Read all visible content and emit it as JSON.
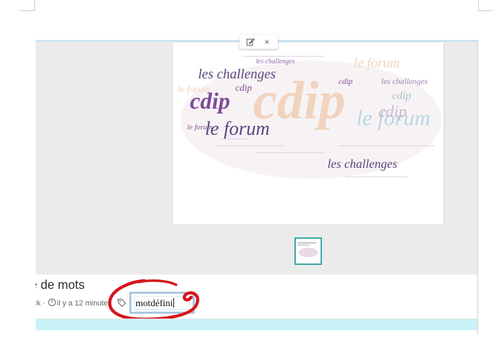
{
  "toolbar": {
    "edit_icon": "edit-icon",
    "close_label": "×"
  },
  "wordcloud": {
    "words": [
      "cdip",
      "cdip",
      "le forum",
      "les challenges",
      "le forum",
      "les challenges",
      "cdip",
      "cdip",
      "le forum",
      "cdip",
      "les challenges",
      "le forum",
      "cdip",
      "le forum",
      "les challenges"
    ]
  },
  "post": {
    "title_visible": "ge de mots",
    "meta_visible": "ck · ",
    "time_text": "il y a 12 minutes",
    "tag_icon": "tag-icon"
  },
  "tag_input": {
    "value": "motdéfini"
  },
  "colors": {
    "accent_blue": "#a9c6e4",
    "thumb_border": "#3aa5a5",
    "annotation_red": "#d8141b",
    "band_cyan": "#c8f1f8"
  }
}
